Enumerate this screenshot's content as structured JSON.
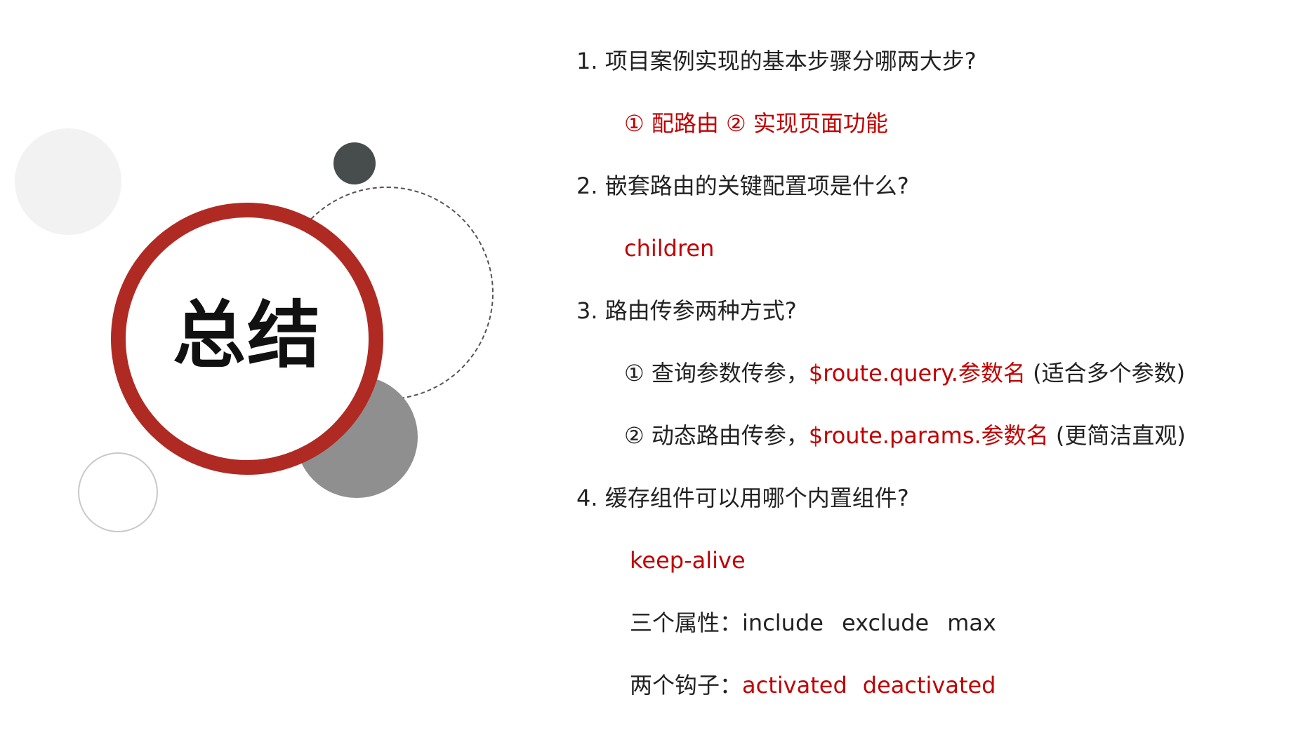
{
  "title": "总结",
  "colors": {
    "accent": "#c00000",
    "ring": "#b02a24",
    "text": "#222222"
  },
  "q1": {
    "question": "1. 项目案例实现的基本步骤分哪两大步?",
    "answer": "① 配路由 ② 实现页面功能"
  },
  "q2": {
    "question": "2. 嵌套路由的关键配置项是什么?",
    "answer": "children"
  },
  "q3": {
    "question": "3. 路由传参两种方式?",
    "item1": {
      "label": "① 查询参数传参，",
      "code": "$route.query.参数名",
      "note": " (适合多个参数)"
    },
    "item2": {
      "label": "② 动态路由传参，",
      "code": "$route.params.参数名",
      "note": " (更简洁直观)"
    }
  },
  "q4": {
    "question": "4. 缓存组件可以用哪个内置组件?",
    "answer": "keep-alive",
    "props_label": "三个属性：",
    "props": [
      "include",
      "exclude",
      "max"
    ],
    "hooks_label": "两个钩子：",
    "hooks": [
      "activated",
      "deactivated"
    ]
  }
}
